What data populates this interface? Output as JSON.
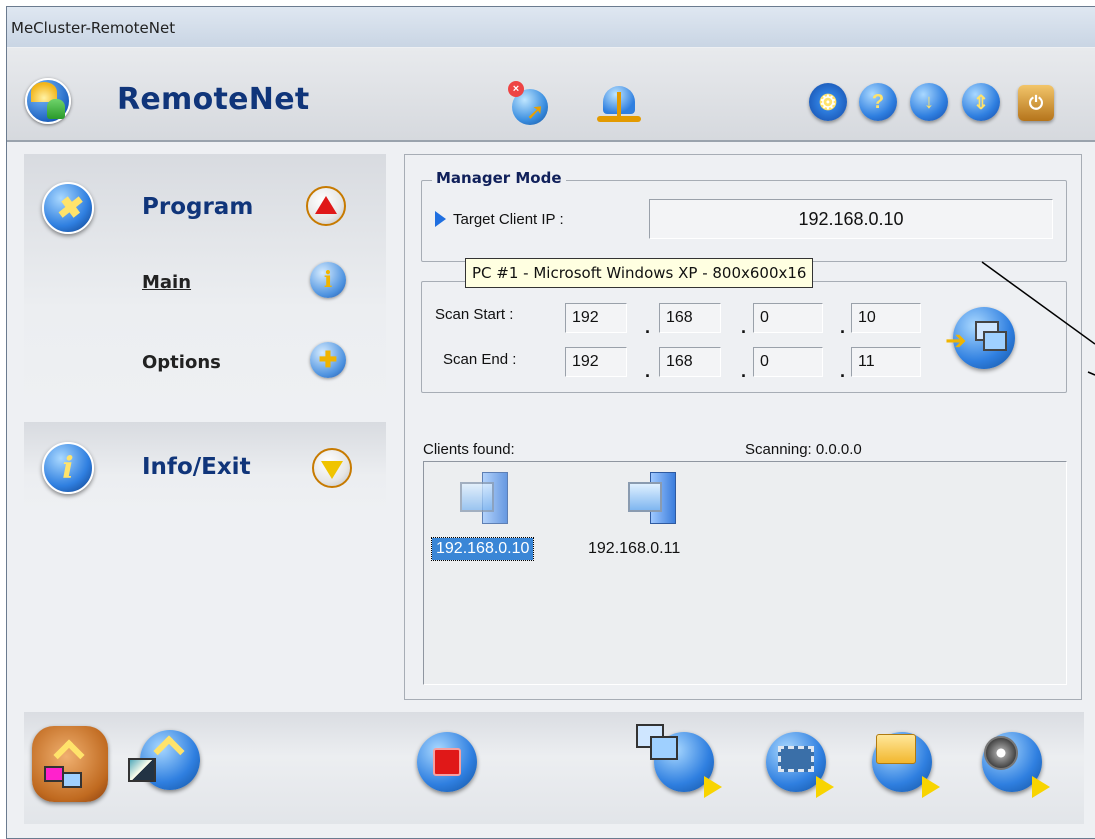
{
  "window": {
    "title": "MeCluster-RemoteNet"
  },
  "app": {
    "title": "RemoteNet"
  },
  "toolbar": {
    "buttons": [
      "globe-disconnect-icon",
      "network-icon",
      "settings-icon",
      "help-icon",
      "download-icon",
      "upload-icon",
      "power-icon"
    ]
  },
  "sidebar": {
    "program": {
      "title": "Program",
      "items": [
        {
          "label": "Main"
        },
        {
          "label": "Options"
        }
      ]
    },
    "info_exit": {
      "title": "Info/Exit"
    }
  },
  "manager": {
    "legend": "Manager Mode",
    "target_label": "Target Client IP :",
    "target_ip": "192.168.0.10"
  },
  "tooltip": {
    "text": "PC #1 - Microsoft Windows XP - 800x600x16"
  },
  "scan": {
    "start_label": "Scan Start :",
    "end_label": "Scan End :",
    "start": [
      "192",
      "168",
      "0",
      "10"
    ],
    "end": [
      "192",
      "168",
      "0",
      "11"
    ]
  },
  "clients": {
    "found_label": "Clients found:",
    "scanning_label": "Scanning: 0.0.0.0",
    "items": [
      {
        "ip": "192.168.0.10",
        "selected": true
      },
      {
        "ip": "192.168.0.11",
        "selected": false
      }
    ]
  },
  "bottom": {
    "buttons": [
      "client-list-icon",
      "screen-view-icon",
      "stop-icon",
      "remote-desktop-icon",
      "video-icon",
      "file-transfer-icon",
      "audio-icon"
    ]
  }
}
